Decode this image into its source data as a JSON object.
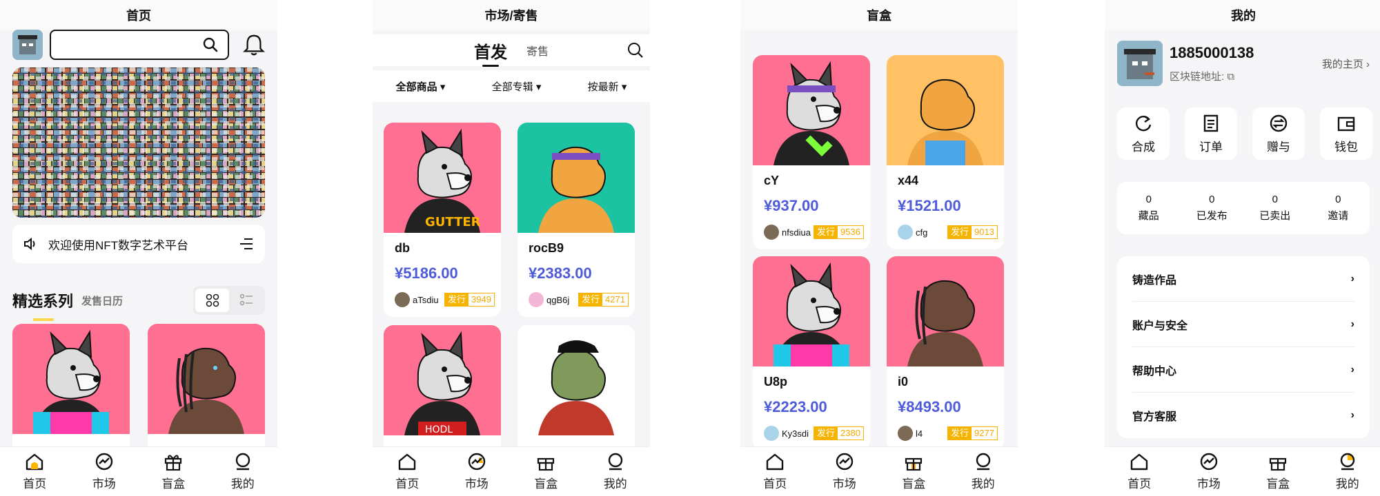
{
  "colors": {
    "price": "#4d5bd8",
    "accent": "#f6b400",
    "pink": "#ff6f91",
    "teal": "#1bc3a2",
    "orange": "#ffc163"
  },
  "nav": {
    "home": "首页",
    "market": "市场",
    "blindbox": "盲盒",
    "mine": "我的"
  },
  "p1": {
    "title": "首页",
    "notice": "欢迎使用NFT数字艺术平台",
    "section_title": "精选系列",
    "section_sub": "发售日历"
  },
  "p2": {
    "title": "市场/寄售",
    "tab_first": "首发",
    "tab_resale": "寄售",
    "filters": [
      "全部商品",
      "全部专辑",
      "按最新"
    ],
    "cards": [
      {
        "name": "db",
        "price": "¥5186.00",
        "creator": "aTsdiu",
        "issue_label": "发行",
        "issue_count": "3949"
      },
      {
        "name": "rocB9",
        "price": "¥2383.00",
        "creator": "qgB6j",
        "issue_label": "发行",
        "issue_count": "4271"
      }
    ]
  },
  "p3": {
    "title": "盲盒",
    "cards": [
      {
        "name": "cY",
        "price": "¥937.00",
        "creator": "nfsdiua",
        "issue_label": "发行",
        "issue_count": "9536"
      },
      {
        "name": "x44",
        "price": "¥1521.00",
        "creator": "cfg",
        "issue_label": "发行",
        "issue_count": "9013"
      },
      {
        "name": "U8p",
        "price": "¥2223.00",
        "creator": "Ky3sdi",
        "issue_label": "发行",
        "issue_count": "2380"
      },
      {
        "name": "i0",
        "price": "¥8493.00",
        "creator": "l4",
        "issue_label": "发行",
        "issue_count": "9277"
      }
    ]
  },
  "p4": {
    "title": "我的",
    "phone": "1885000138",
    "chain_addr": "区块链地址:",
    "my_home": "我的主页",
    "quick": [
      "合成",
      "订单",
      "赠与",
      "钱包"
    ],
    "stats": [
      {
        "num": "0",
        "label": "藏品"
      },
      {
        "num": "0",
        "label": "已发布"
      },
      {
        "num": "0",
        "label": "已卖出"
      },
      {
        "num": "0",
        "label": "邀请"
      }
    ],
    "menu": [
      "铸造作品",
      "账户与安全",
      "帮助中心",
      "官方客服"
    ]
  }
}
